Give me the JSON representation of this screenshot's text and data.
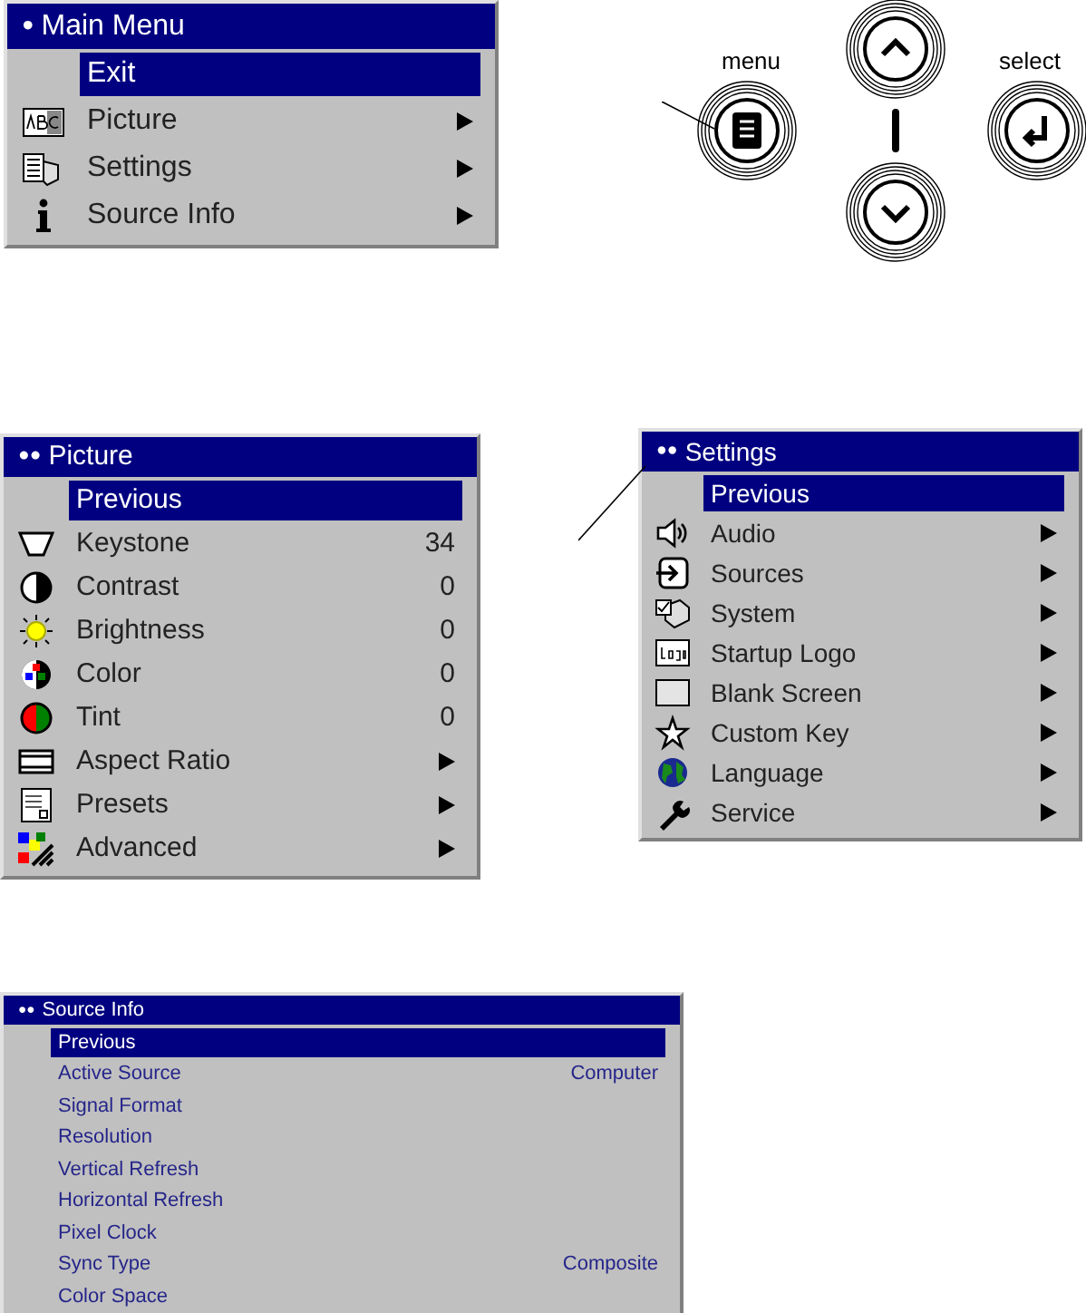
{
  "main_menu": {
    "marker": "●",
    "title": "Main Menu",
    "items": [
      {
        "label": "Exit",
        "selected": true,
        "submenu": false
      },
      {
        "label": "Picture",
        "selected": false,
        "submenu": true
      },
      {
        "label": "Settings",
        "selected": false,
        "submenu": true
      },
      {
        "label": "Source Info",
        "selected": false,
        "submenu": true
      }
    ]
  },
  "remote": {
    "menu_label": "menu",
    "select_label": "select"
  },
  "picture_menu": {
    "marker": "●●",
    "title": "Picture",
    "items": [
      {
        "label": "Previous",
        "selected": true,
        "submenu": false
      },
      {
        "label": "Keystone",
        "value": "34",
        "selected": false,
        "submenu": false
      },
      {
        "label": "Contrast",
        "value": "0",
        "selected": false,
        "submenu": false
      },
      {
        "label": "Brightness",
        "value": "0",
        "selected": false,
        "submenu": false
      },
      {
        "label": "Color",
        "value": "0",
        "selected": false,
        "submenu": false
      },
      {
        "label": "Tint",
        "value": "0",
        "selected": false,
        "submenu": false
      },
      {
        "label": "Aspect Ratio",
        "selected": false,
        "submenu": true
      },
      {
        "label": "Presets",
        "selected": false,
        "submenu": true
      },
      {
        "label": "Advanced",
        "selected": false,
        "submenu": true
      }
    ]
  },
  "settings_menu": {
    "marker": "●●",
    "title": "Settings",
    "items": [
      {
        "label": "Previous",
        "selected": true,
        "submenu": false
      },
      {
        "label": "Audio",
        "selected": false,
        "submenu": true
      },
      {
        "label": "Sources",
        "selected": false,
        "submenu": true
      },
      {
        "label": "System",
        "selected": false,
        "submenu": true
      },
      {
        "label": "Startup Logo",
        "selected": false,
        "submenu": true
      },
      {
        "label": "Blank Screen",
        "selected": false,
        "submenu": true
      },
      {
        "label": "Custom Key",
        "selected": false,
        "submenu": true
      },
      {
        "label": "Language",
        "selected": false,
        "submenu": true
      },
      {
        "label": "Service",
        "selected": false,
        "submenu": true
      }
    ]
  },
  "source_info_menu": {
    "marker": "●●",
    "title": "Source Info",
    "items": [
      {
        "label": "Previous",
        "selected": true
      },
      {
        "label": "Active Source",
        "value": "Computer",
        "selected": false
      },
      {
        "label": "Signal Format",
        "selected": false
      },
      {
        "label": "Resolution",
        "selected": false
      },
      {
        "label": "Vertical Refresh",
        "selected": false
      },
      {
        "label": "Horizontal Refresh",
        "selected": false
      },
      {
        "label": "Pixel Clock",
        "selected": false
      },
      {
        "label": "Sync Type",
        "value": "Composite",
        "selected": false
      },
      {
        "label": "Color Space",
        "selected": false
      }
    ]
  }
}
